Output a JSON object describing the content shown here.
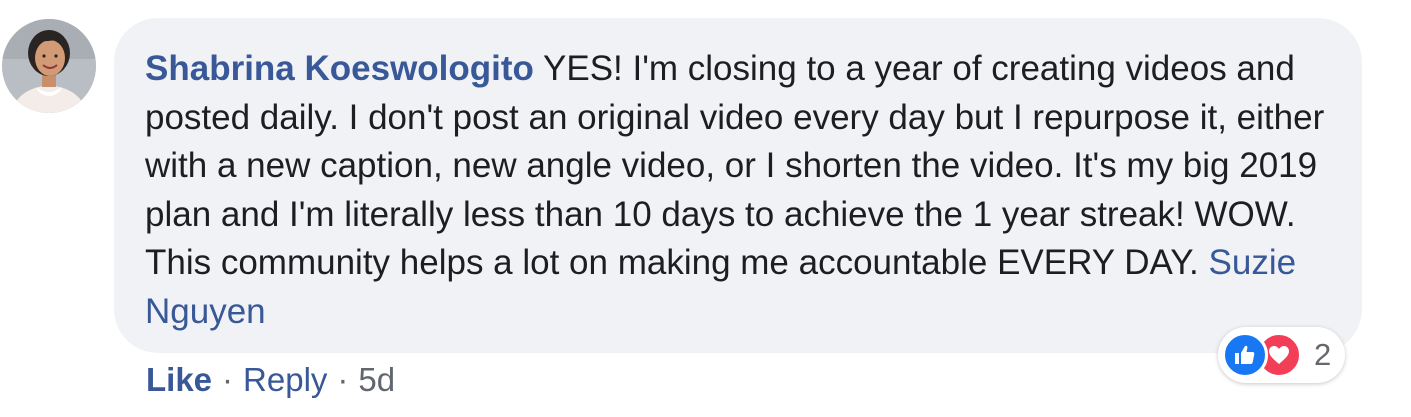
{
  "comment": {
    "author": "Shabrina Koeswologito",
    "text": "YES! I'm closing to a year of creating videos and posted daily. I don't post an original video every day but I repurpose it, either with a new caption, new angle video, or I shorten the video. It's my big 2019 plan and I'm literally less than 10 days to achieve the 1 year streak! WOW. This community helps a lot on making me accountable EVERY DAY.",
    "mention": "Suzie Nguyen"
  },
  "reactions": {
    "icons": [
      "thumbs-up-icon",
      "heart-icon"
    ],
    "count": "2"
  },
  "actions": {
    "like_label": "Like",
    "reply_label": "Reply",
    "separator": "·",
    "timestamp": "5d"
  },
  "colors": {
    "link": "#385898",
    "bubble": "#f0f2f5",
    "like_blue": "#1877f2",
    "love_red": "#f33e58",
    "meta_gray": "#606770"
  }
}
